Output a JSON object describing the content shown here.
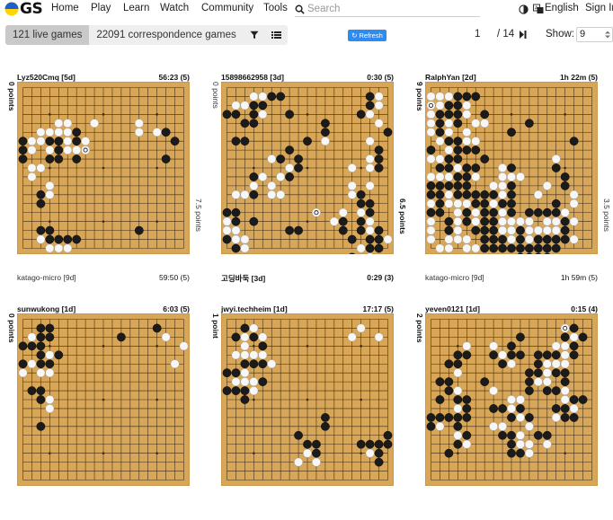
{
  "nav": {
    "logo_text": "GS",
    "links": [
      "Home",
      "Play",
      "Learn",
      "Watch",
      "Community",
      "Tools"
    ],
    "search_placeholder": "Search",
    "language": "English",
    "sign_in": "Sign In"
  },
  "toolbar": {
    "live_games": "121 live games",
    "correspondence_games": "22091 correspondence games",
    "refresh": "Refresh",
    "page_current": "1",
    "page_total": "/ 14",
    "show_label": "Show:",
    "show_value": "9"
  },
  "colors": {
    "board": "#d7a659",
    "board_edge": "#c99347",
    "refresh": "#2e8bf0",
    "active_tab": "#c9c9c9"
  },
  "games": [
    {
      "top": {
        "name": "Lyz520Cmq  [5d]",
        "clock": "56:23  (5)"
      },
      "bottom": {
        "name": "katago-micro  [9d]",
        "clock": "59:50  (5)"
      },
      "bottom_bold": false,
      "score_left": "0 points",
      "score_left_bold": true,
      "score_right": "7.5 points",
      "score_right_bold": false,
      "rows": [
        "...................",
        "...................",
        "...................",
        "...................",
        "....WW..W....W.....",
        "..WWWWB......W.WB..",
        "BWWBBWBW.........B.",
        "BW.WBWWo...........",
        "B..BB.B.........B..",
        ".WW................",
        ".W.................",
        "...W...............",
        "..BW...............",
        "..B................",
        "...................",
        "...................",
        "..BB.........B.....",
        "..WBBBB............",
        "...WWW.............",
        "..................."
      ]
    },
    {
      "top": {
        "name": "15898662958  [3d]",
        "clock": "0:30  (5)"
      },
      "bottom": {
        "name": "고딩바둑  [3d]",
        "clock": "0:29  (3)"
      },
      "bottom_bold": true,
      "score_left": "0 points",
      "score_left_bold": false,
      "score_right": "6.5 points",
      "score_right_bold": true,
      "rows": [
        "...................",
        "...WWBB.........BW.",
        ".WWBB...........BW.",
        "BB.BW..B.......BW..",
        "..BB.......B.....W.",
        "...........B......B",
        ".BB......B.W....W..",
        ".......B.........B.",
        ".....WB.B.......WB.",
        ".......WB.....W.WB.",
        "...BW.WB...........",
        "...W.W........W.W..",
        ".WWB.WW.......WB...",
        "...............BB..",
        "BB........o..W.WB..",
        "WB.B........WB.BW..",
        "WW.....BB....B.BWB.",
        "BWW...........B.BBW",
        ".BW............WBB.",
        "..............B.W.."
      ]
    },
    {
      "top": {
        "name": "RalphYan  [2d]",
        "clock": "1h 22m  (5)"
      },
      "bottom": {
        "name": "katago-micro  [9d]",
        "clock": "1h 59m  (5)"
      },
      "bottom_bold": false,
      "score_left": "9 points",
      "score_left_bold": true,
      "score_right": "3.5 points",
      "score_right_bold": false,
      "rows": [
        "...................",
        "WWWBBB.............",
        "oWBBW..............",
        "WBBBW.B............",
        "WBWB.WW....B.......",
        "WBW.W....B.........",
        ".WBBWW..........B..",
        "B.WBBB.............",
        "WWBB..B.......W....",
        ".BBWBB..WB....B....",
        "WWWBBW..WWW....B...",
        "BBBBB..WWB...W.B...",
        "BBWBBBBBWB..W...W..",
        "WBWWWBBWBB....B.W..",
        "BB.WBWBBWB.BBBBW...",
        "W.BWBWBBWWWW.WWBW..",
        "W.BW.BBBWWBWWWWB...",
        "W.WWW.BBBWBWBBBBW..",
        ".WW.WWBBBBBBBBB....",
        "..........BBBB....."
      ]
    },
    {
      "top": {
        "name": "sunwukong  [1d]",
        "clock": "6:03  (5)"
      },
      "bottom": {
        "name": "",
        "clock": ""
      },
      "bottom_bold": false,
      "score_left": "0 points",
      "score_left_bold": true,
      "score_right": "",
      "score_right_bold": false,
      "rows": [
        "...................",
        "..BB...........B...",
        ".WBB.......B....W..",
        "BBB...............W",
        "..BWB.............",
        "BWBB.............W.",
        "W.WW...............",
        "...................",
        ".BB...............",
        "..BW...............",
        "...W...............",
        "...................",
        "..B................",
        "...................",
        "...................",
        "...................",
        "...................",
        "...................",
        "...................",
        "..................."
      ]
    },
    {
      "top": {
        "name": "jwyi.techheim  [1d]",
        "clock": "17:17  (5)"
      },
      "bottom": {
        "name": "",
        "clock": ""
      },
      "bottom_bold": false,
      "score_left": "1 point",
      "score_left_bold": true,
      "score_right": "",
      "score_right_bold": false,
      "rows": [
        "...................",
        "..BW...........W...",
        ".BWBW.........W..W.",
        "..W.B..............",
        ".WWWW..............",
        "..BBBW.............",
        "BBW................",
        ".WWWB..............",
        "BBBW...............",
        "..B................",
        "...................",
        "...........B.......",
        "...........B.......",
        "........B.........B",
        ".........BB....BBBB",
        ".........WB.....WB.",
        "........W.W......B.",
        "...................",
        "...................",
        "..................."
      ]
    },
    {
      "top": {
        "name": "yeven0121  [1d]",
        "clock": "0:15  (4)"
      },
      "bottom": {
        "name": "",
        "clock": ""
      },
      "bottom_bold": false,
      "score_left": "2 points",
      "score_left_bold": true,
      "score_right": "",
      "score_right_bold": false,
      "rows": [
        "...................",
        "...............oB..",
        "..........B....BWB.",
        "....W..W.B....WWB..",
        "...BB..BWBB.BBBWB..",
        "..BB....BW..BWWW...",
        "...W.......BBWBB...",
        ".BB...B....BWW.B...",
        "..BW...W...B.BBW...",
        ".B.BB....WW....WBB.",
        "...WB..BBWB...BBW..",
        "BBBBB....BWB..WBB..",
        "BW.B...WW..W.......",
        "...WB...BBW.BB.....",
        "...BW....BWW.W.....",
        "..B......BBW.......",
        "...................",
        "...................",
        "...................",
        "..................."
      ]
    }
  ]
}
